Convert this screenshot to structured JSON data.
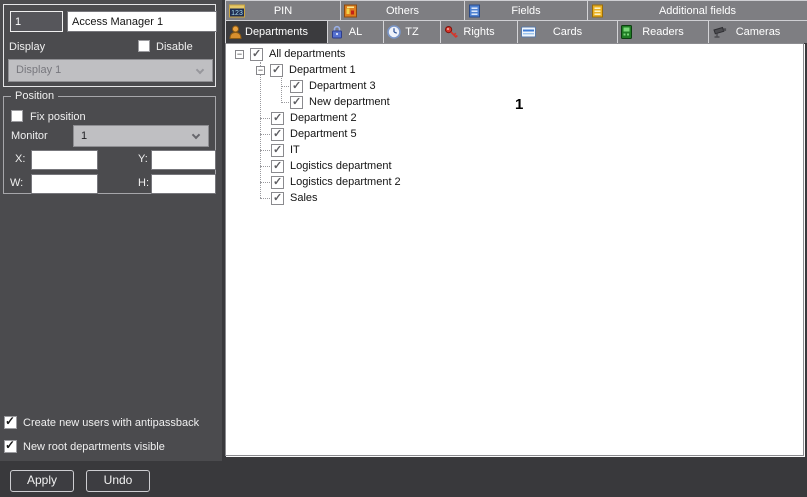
{
  "icons": {
    "check_glyph": "✓",
    "collapse_glyph": "−",
    "pin_text": "123"
  },
  "left_panel": {
    "id_field": {
      "value": "1"
    },
    "name_field": {
      "value": "Access Manager 1"
    },
    "display_label": "Display",
    "disable_checkbox": {
      "label": "Disable",
      "checked": false
    },
    "display_dropdown": {
      "value": "Display 1",
      "disabled": true
    },
    "position_group": {
      "title": "Position",
      "fix_position_checkbox": {
        "label": "Fix position",
        "checked": false
      },
      "monitor_label": "Monitor",
      "monitor_dropdown": {
        "value": "1"
      },
      "x_label": "X:",
      "x_value": "",
      "y_label": "Y:",
      "y_value": "",
      "w_label": "W:",
      "w_value": "",
      "h_label": "H:",
      "h_value": ""
    },
    "options": [
      {
        "label": "Create new users with antipassback",
        "checked": true
      },
      {
        "label": "New root departments visible",
        "checked": true
      }
    ],
    "buttons": {
      "apply": "Apply",
      "undo": "Undo"
    }
  },
  "tabs_row1": {
    "items": [
      {
        "label": "PIN"
      },
      {
        "label": "Others"
      },
      {
        "label": "Fields"
      },
      {
        "label": "Additional fields"
      }
    ]
  },
  "tabs_row2": {
    "items": [
      {
        "label": "Departments",
        "active": true
      },
      {
        "label": "AL",
        "active": false
      },
      {
        "label": "TZ",
        "active": false
      },
      {
        "label": "Rights",
        "active": false
      },
      {
        "label": "Cards",
        "active": false
      },
      {
        "label": "Readers",
        "active": false
      },
      {
        "label": "Cameras",
        "active": false
      }
    ]
  },
  "tree": {
    "items": [
      {
        "label": "All departments",
        "level": 0,
        "checked": true,
        "expanded": true
      },
      {
        "label": "Department 1",
        "level": 1,
        "checked": true,
        "expanded": true
      },
      {
        "label": "Department 3",
        "level": 2,
        "checked": true
      },
      {
        "label": "New department",
        "level": 2,
        "checked": true
      },
      {
        "label": "Department 2",
        "level": 1,
        "checked": true
      },
      {
        "label": "Department 5",
        "level": 1,
        "checked": true
      },
      {
        "label": "IT",
        "level": 1,
        "checked": true
      },
      {
        "label": "Logistics department",
        "level": 1,
        "checked": true
      },
      {
        "label": "Logistics department 2",
        "level": 1,
        "checked": true
      },
      {
        "label": "Sales",
        "level": 1,
        "checked": true
      }
    ]
  },
  "annotation": {
    "text": "1"
  },
  "colors": {
    "panel_bg": "#4b4b4e",
    "strip_bg": "#39393c",
    "tab_bg": "#7e7e82",
    "tab_active_bg": "#3b3b3e",
    "tree_bg": "#ffffff",
    "border_light": "#e4e4e6"
  }
}
